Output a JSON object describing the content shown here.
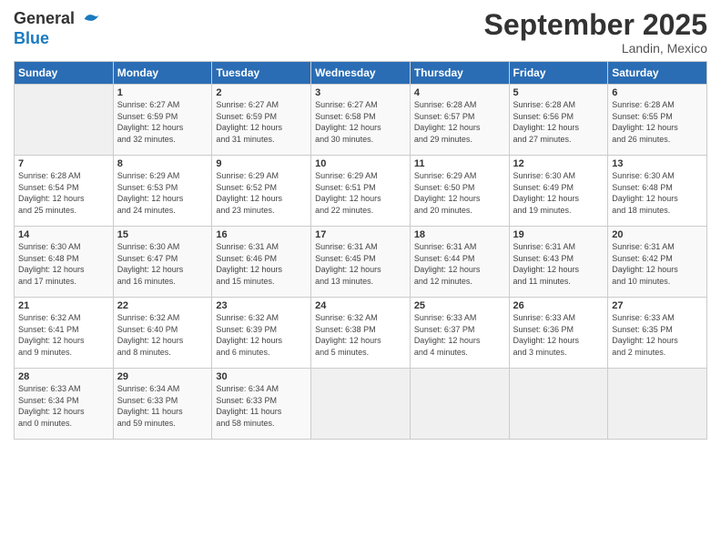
{
  "logo": {
    "general": "General",
    "blue": "Blue"
  },
  "title": "September 2025",
  "location": "Landin, Mexico",
  "days_header": [
    "Sunday",
    "Monday",
    "Tuesday",
    "Wednesday",
    "Thursday",
    "Friday",
    "Saturday"
  ],
  "weeks": [
    [
      {
        "num": "",
        "info": ""
      },
      {
        "num": "1",
        "info": "Sunrise: 6:27 AM\nSunset: 6:59 PM\nDaylight: 12 hours\nand 32 minutes."
      },
      {
        "num": "2",
        "info": "Sunrise: 6:27 AM\nSunset: 6:59 PM\nDaylight: 12 hours\nand 31 minutes."
      },
      {
        "num": "3",
        "info": "Sunrise: 6:27 AM\nSunset: 6:58 PM\nDaylight: 12 hours\nand 30 minutes."
      },
      {
        "num": "4",
        "info": "Sunrise: 6:28 AM\nSunset: 6:57 PM\nDaylight: 12 hours\nand 29 minutes."
      },
      {
        "num": "5",
        "info": "Sunrise: 6:28 AM\nSunset: 6:56 PM\nDaylight: 12 hours\nand 27 minutes."
      },
      {
        "num": "6",
        "info": "Sunrise: 6:28 AM\nSunset: 6:55 PM\nDaylight: 12 hours\nand 26 minutes."
      }
    ],
    [
      {
        "num": "7",
        "info": "Sunrise: 6:28 AM\nSunset: 6:54 PM\nDaylight: 12 hours\nand 25 minutes."
      },
      {
        "num": "8",
        "info": "Sunrise: 6:29 AM\nSunset: 6:53 PM\nDaylight: 12 hours\nand 24 minutes."
      },
      {
        "num": "9",
        "info": "Sunrise: 6:29 AM\nSunset: 6:52 PM\nDaylight: 12 hours\nand 23 minutes."
      },
      {
        "num": "10",
        "info": "Sunrise: 6:29 AM\nSunset: 6:51 PM\nDaylight: 12 hours\nand 22 minutes."
      },
      {
        "num": "11",
        "info": "Sunrise: 6:29 AM\nSunset: 6:50 PM\nDaylight: 12 hours\nand 20 minutes."
      },
      {
        "num": "12",
        "info": "Sunrise: 6:30 AM\nSunset: 6:49 PM\nDaylight: 12 hours\nand 19 minutes."
      },
      {
        "num": "13",
        "info": "Sunrise: 6:30 AM\nSunset: 6:48 PM\nDaylight: 12 hours\nand 18 minutes."
      }
    ],
    [
      {
        "num": "14",
        "info": "Sunrise: 6:30 AM\nSunset: 6:48 PM\nDaylight: 12 hours\nand 17 minutes."
      },
      {
        "num": "15",
        "info": "Sunrise: 6:30 AM\nSunset: 6:47 PM\nDaylight: 12 hours\nand 16 minutes."
      },
      {
        "num": "16",
        "info": "Sunrise: 6:31 AM\nSunset: 6:46 PM\nDaylight: 12 hours\nand 15 minutes."
      },
      {
        "num": "17",
        "info": "Sunrise: 6:31 AM\nSunset: 6:45 PM\nDaylight: 12 hours\nand 13 minutes."
      },
      {
        "num": "18",
        "info": "Sunrise: 6:31 AM\nSunset: 6:44 PM\nDaylight: 12 hours\nand 12 minutes."
      },
      {
        "num": "19",
        "info": "Sunrise: 6:31 AM\nSunset: 6:43 PM\nDaylight: 12 hours\nand 11 minutes."
      },
      {
        "num": "20",
        "info": "Sunrise: 6:31 AM\nSunset: 6:42 PM\nDaylight: 12 hours\nand 10 minutes."
      }
    ],
    [
      {
        "num": "21",
        "info": "Sunrise: 6:32 AM\nSunset: 6:41 PM\nDaylight: 12 hours\nand 9 minutes."
      },
      {
        "num": "22",
        "info": "Sunrise: 6:32 AM\nSunset: 6:40 PM\nDaylight: 12 hours\nand 8 minutes."
      },
      {
        "num": "23",
        "info": "Sunrise: 6:32 AM\nSunset: 6:39 PM\nDaylight: 12 hours\nand 6 minutes."
      },
      {
        "num": "24",
        "info": "Sunrise: 6:32 AM\nSunset: 6:38 PM\nDaylight: 12 hours\nand 5 minutes."
      },
      {
        "num": "25",
        "info": "Sunrise: 6:33 AM\nSunset: 6:37 PM\nDaylight: 12 hours\nand 4 minutes."
      },
      {
        "num": "26",
        "info": "Sunrise: 6:33 AM\nSunset: 6:36 PM\nDaylight: 12 hours\nand 3 minutes."
      },
      {
        "num": "27",
        "info": "Sunrise: 6:33 AM\nSunset: 6:35 PM\nDaylight: 12 hours\nand 2 minutes."
      }
    ],
    [
      {
        "num": "28",
        "info": "Sunrise: 6:33 AM\nSunset: 6:34 PM\nDaylight: 12 hours\nand 0 minutes."
      },
      {
        "num": "29",
        "info": "Sunrise: 6:34 AM\nSunset: 6:33 PM\nDaylight: 11 hours\nand 59 minutes."
      },
      {
        "num": "30",
        "info": "Sunrise: 6:34 AM\nSunset: 6:33 PM\nDaylight: 11 hours\nand 58 minutes."
      },
      {
        "num": "",
        "info": ""
      },
      {
        "num": "",
        "info": ""
      },
      {
        "num": "",
        "info": ""
      },
      {
        "num": "",
        "info": ""
      }
    ]
  ]
}
